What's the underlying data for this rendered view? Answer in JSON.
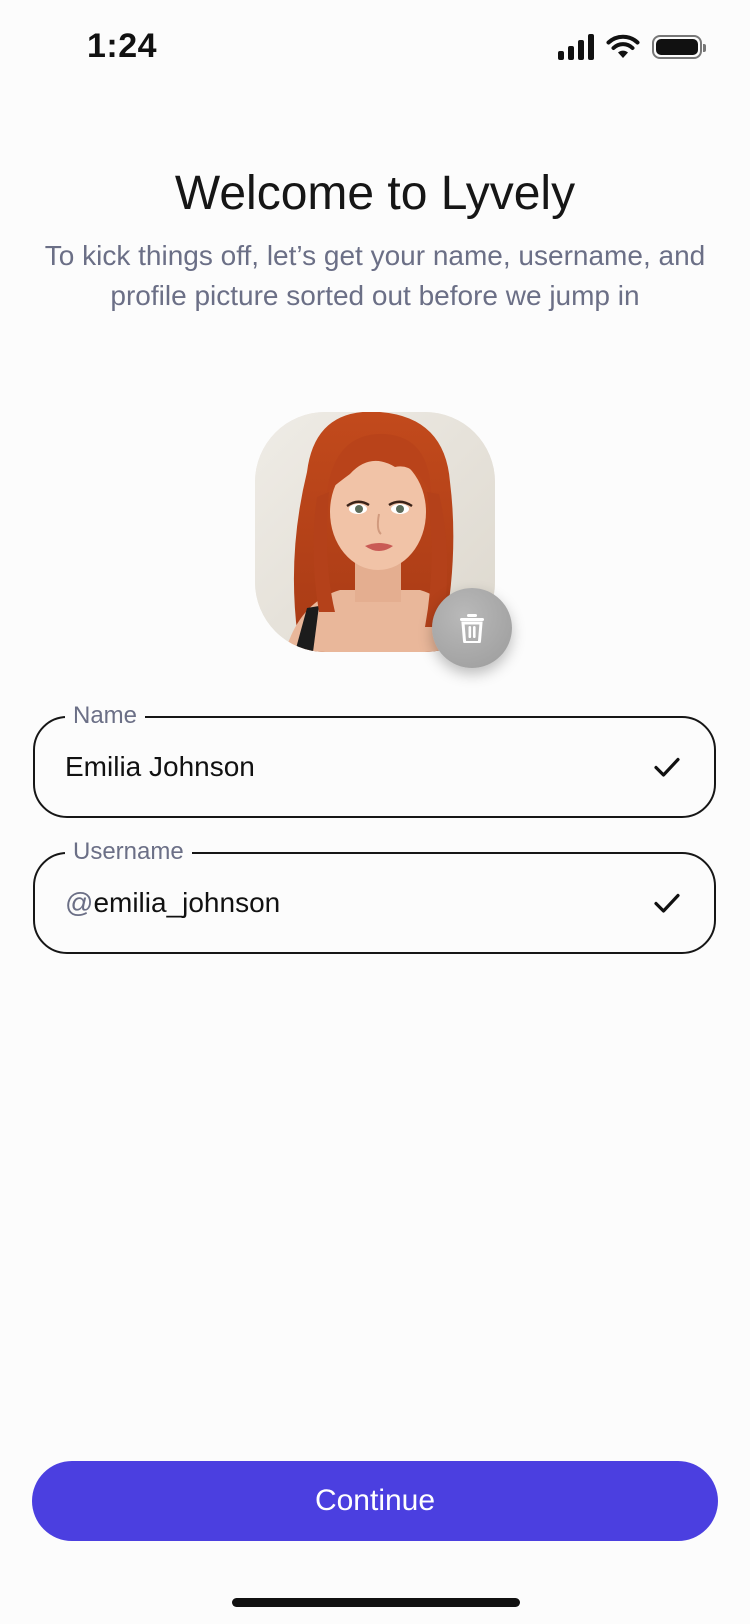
{
  "status_bar": {
    "time": "1:24",
    "icons": [
      "cellular-signal-icon",
      "wifi-icon",
      "battery-icon"
    ]
  },
  "header": {
    "title": "Welcome to Lyvely",
    "subtitle": "To kick things off, let’s get your name, username, and profile picture sorted out before we jump in"
  },
  "profile_picture": {
    "delete_icon": "trash-icon"
  },
  "form": {
    "name": {
      "label": "Name",
      "value": "Emilia Johnson",
      "status_icon": "checkmark-icon"
    },
    "username": {
      "label": "Username",
      "prefix": "@",
      "value": "emilia_johnson",
      "status_icon": "checkmark-icon"
    }
  },
  "actions": {
    "continue_label": "Continue"
  },
  "colors": {
    "accent": "#4b3fe0",
    "subtitle": "#6b6f86",
    "background": "#fcfcfc"
  }
}
